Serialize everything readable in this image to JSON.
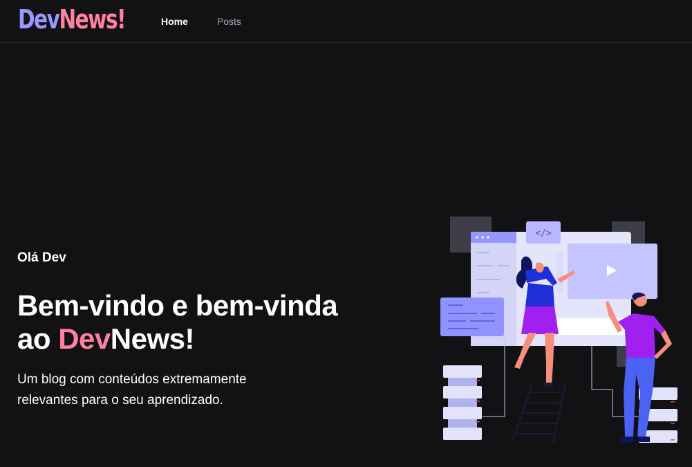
{
  "header": {
    "logo": {
      "part1": "Dev",
      "part2": "News!"
    },
    "nav": [
      {
        "label": "Home",
        "active": true
      },
      {
        "label": "Posts",
        "active": false
      }
    ]
  },
  "hero": {
    "greeting": "Olá Dev",
    "title_line1": "Bem-vindo e bem-vinda",
    "title_prefix": "ao ",
    "title_highlight": "Dev",
    "title_suffix": "News!",
    "description": "Um blog com conteúdos extremamente relevantes para o seu aprendizado."
  },
  "colors": {
    "background": "#121214",
    "accent_pink": "#ff80a0",
    "accent_purple": "#9797ff",
    "muted_text": "#a8a8b3"
  },
  "illustration": {
    "icon": "developers-illustration"
  }
}
